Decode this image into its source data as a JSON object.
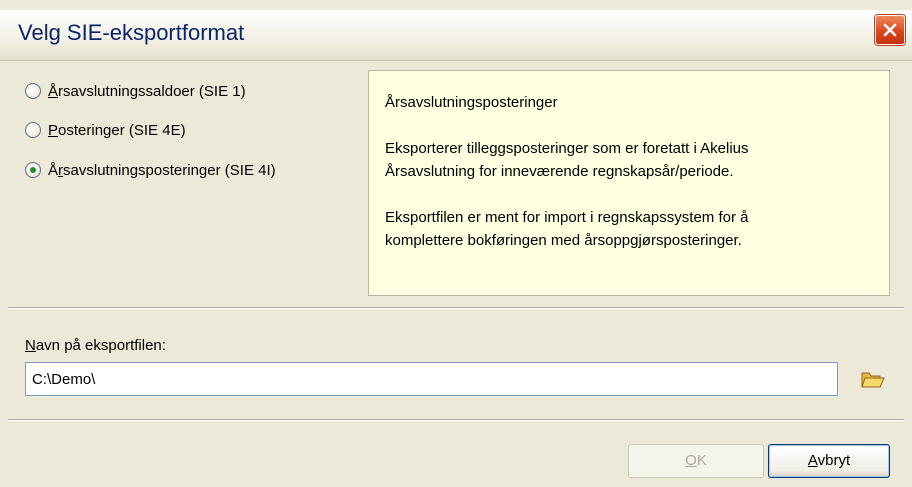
{
  "window": {
    "title": "Velg SIE-eksportformat"
  },
  "options": [
    {
      "prefix": "",
      "mnemonic": "Å",
      "rest": "rsavslutningssaldoer (SIE 1)",
      "checked": false
    },
    {
      "prefix": "",
      "mnemonic": "P",
      "rest": "osteringer (SIE 4E)",
      "checked": false
    },
    {
      "prefix": "Å",
      "mnemonic": "r",
      "rest": "savslutningsposteringer (SIE 4I)",
      "checked": true
    }
  ],
  "description": {
    "title": "Årsavslutningsposteringer",
    "paragraph1": "Eksporterer tilleggsposteringer som er foretatt i Akelius\nÅrsavslutning for inneværende regnskapsår/periode.",
    "paragraph2": "Eksportfilen er ment for import i regnskapssystem for å\nkomplettere bokføringen med årsoppgjørsposteringer."
  },
  "export_file": {
    "label_mnemonic": "N",
    "label_rest": "avn på eksportfilen:",
    "value": "C:\\Demo\\"
  },
  "buttons": {
    "ok_mnemonic": "O",
    "ok_rest": "K",
    "ok_enabled": false,
    "cancel_mnemonic": "A",
    "cancel_rest": "vbryt"
  },
  "icons": {
    "close": "close-icon",
    "folder": "folder-open-icon"
  },
  "colors": {
    "title_text": "#0a246a",
    "close_button": "#d8431b",
    "description_background": "#ffffe1",
    "radio_dot": "#2b8a2b"
  }
}
